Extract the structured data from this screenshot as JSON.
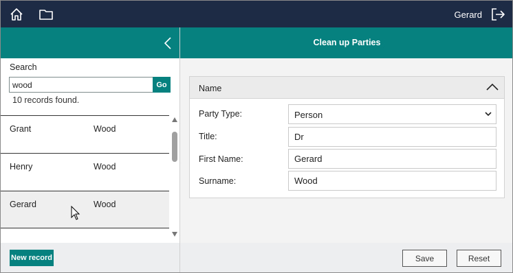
{
  "topbar": {
    "user_name": "Gerard"
  },
  "search": {
    "label": "Search",
    "value": "wood",
    "go_label": "Go",
    "result_text": "10 records found."
  },
  "records": [
    {
      "first": "Grant",
      "last": "Wood"
    },
    {
      "first": "Henry",
      "last": "Wood"
    },
    {
      "first": "Gerard",
      "last": "Wood"
    }
  ],
  "left_footer": {
    "new_record_label": "New record"
  },
  "main": {
    "title": "Clean up Parties",
    "section": {
      "title": "Name",
      "fields": {
        "party_type": {
          "label": "Party Type:",
          "value": "Person"
        },
        "title": {
          "label": "Title:",
          "value": "Dr"
        },
        "first_name": {
          "label": "First Name:",
          "value": "Gerard"
        },
        "surname": {
          "label": "Surname:",
          "value": "Wood"
        }
      }
    },
    "save_label": "Save",
    "reset_label": "Reset"
  },
  "colors": {
    "header": "#1e2b45",
    "accent": "#07817f"
  }
}
